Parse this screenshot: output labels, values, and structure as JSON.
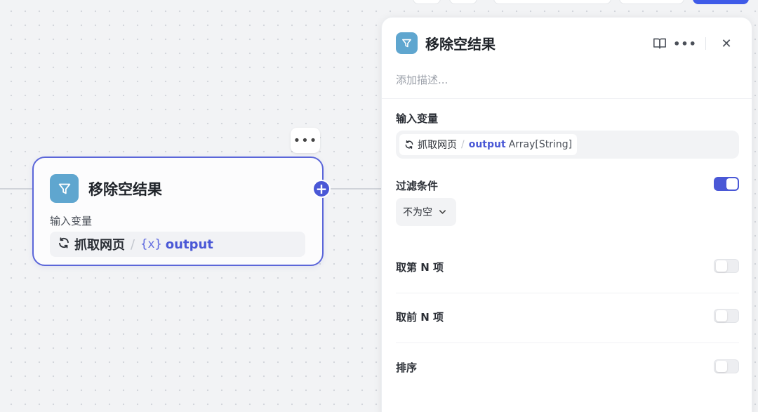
{
  "node": {
    "title": "移除空结果",
    "input_label": "输入变量",
    "variable": {
      "source": "抓取网页",
      "name": "output",
      "var_icon": "{x}"
    },
    "more_icon": "•••",
    "add_icon": "+"
  },
  "panel": {
    "title": "移除空结果",
    "description_placeholder": "添加描述...",
    "input_section_label": "输入变量",
    "input_var": {
      "source": "抓取网页",
      "name": "output",
      "type": "Array[String]"
    },
    "filter": {
      "label": "过滤条件",
      "enabled": true,
      "condition": "不为空"
    },
    "take_nth": {
      "label": "取第 N 项",
      "enabled": false
    },
    "take_first_n": {
      "label": "取前 N 项",
      "enabled": false
    },
    "sort": {
      "label": "排序",
      "enabled": false
    },
    "more_icon": "•••",
    "close_icon": "✕"
  },
  "colors": {
    "accent": "#4a58d6",
    "node_border": "#5b66d9",
    "filter_badge": "#5fa6cf"
  }
}
